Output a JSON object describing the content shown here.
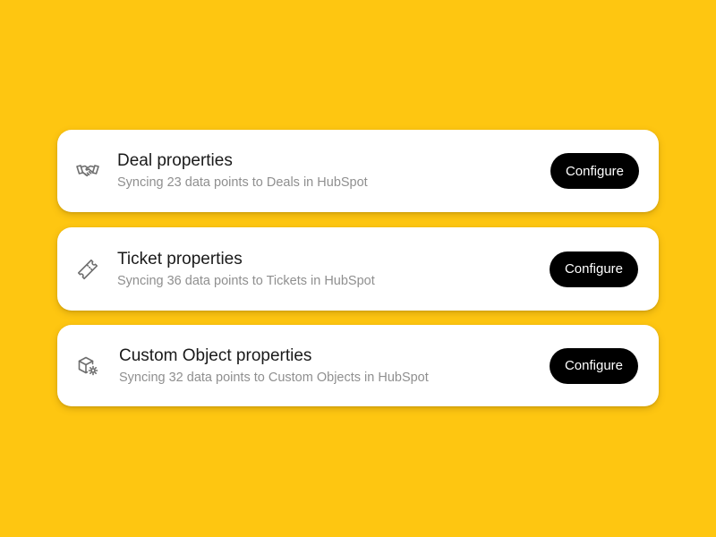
{
  "colors": {
    "background": "#FEC611",
    "card": "#FFFFFF",
    "button": "#000000",
    "button_text": "#FFFFFF",
    "title": "#1A1A1A",
    "subtitle": "#8F8F8F"
  },
  "items": [
    {
      "icon": "handshake-icon",
      "title": "Deal properties",
      "subtitle": "Syncing 23 data points to Deals in HubSpot",
      "button_label": "Configure"
    },
    {
      "icon": "ticket-icon",
      "title": "Ticket properties",
      "subtitle": "Syncing 36 data points to Tickets in HubSpot",
      "button_label": "Configure"
    },
    {
      "icon": "cube-settings-icon",
      "title": "Custom Object properties",
      "subtitle": "Syncing 32 data points to Custom Objects in HubSpot",
      "button_label": "Configure"
    }
  ]
}
